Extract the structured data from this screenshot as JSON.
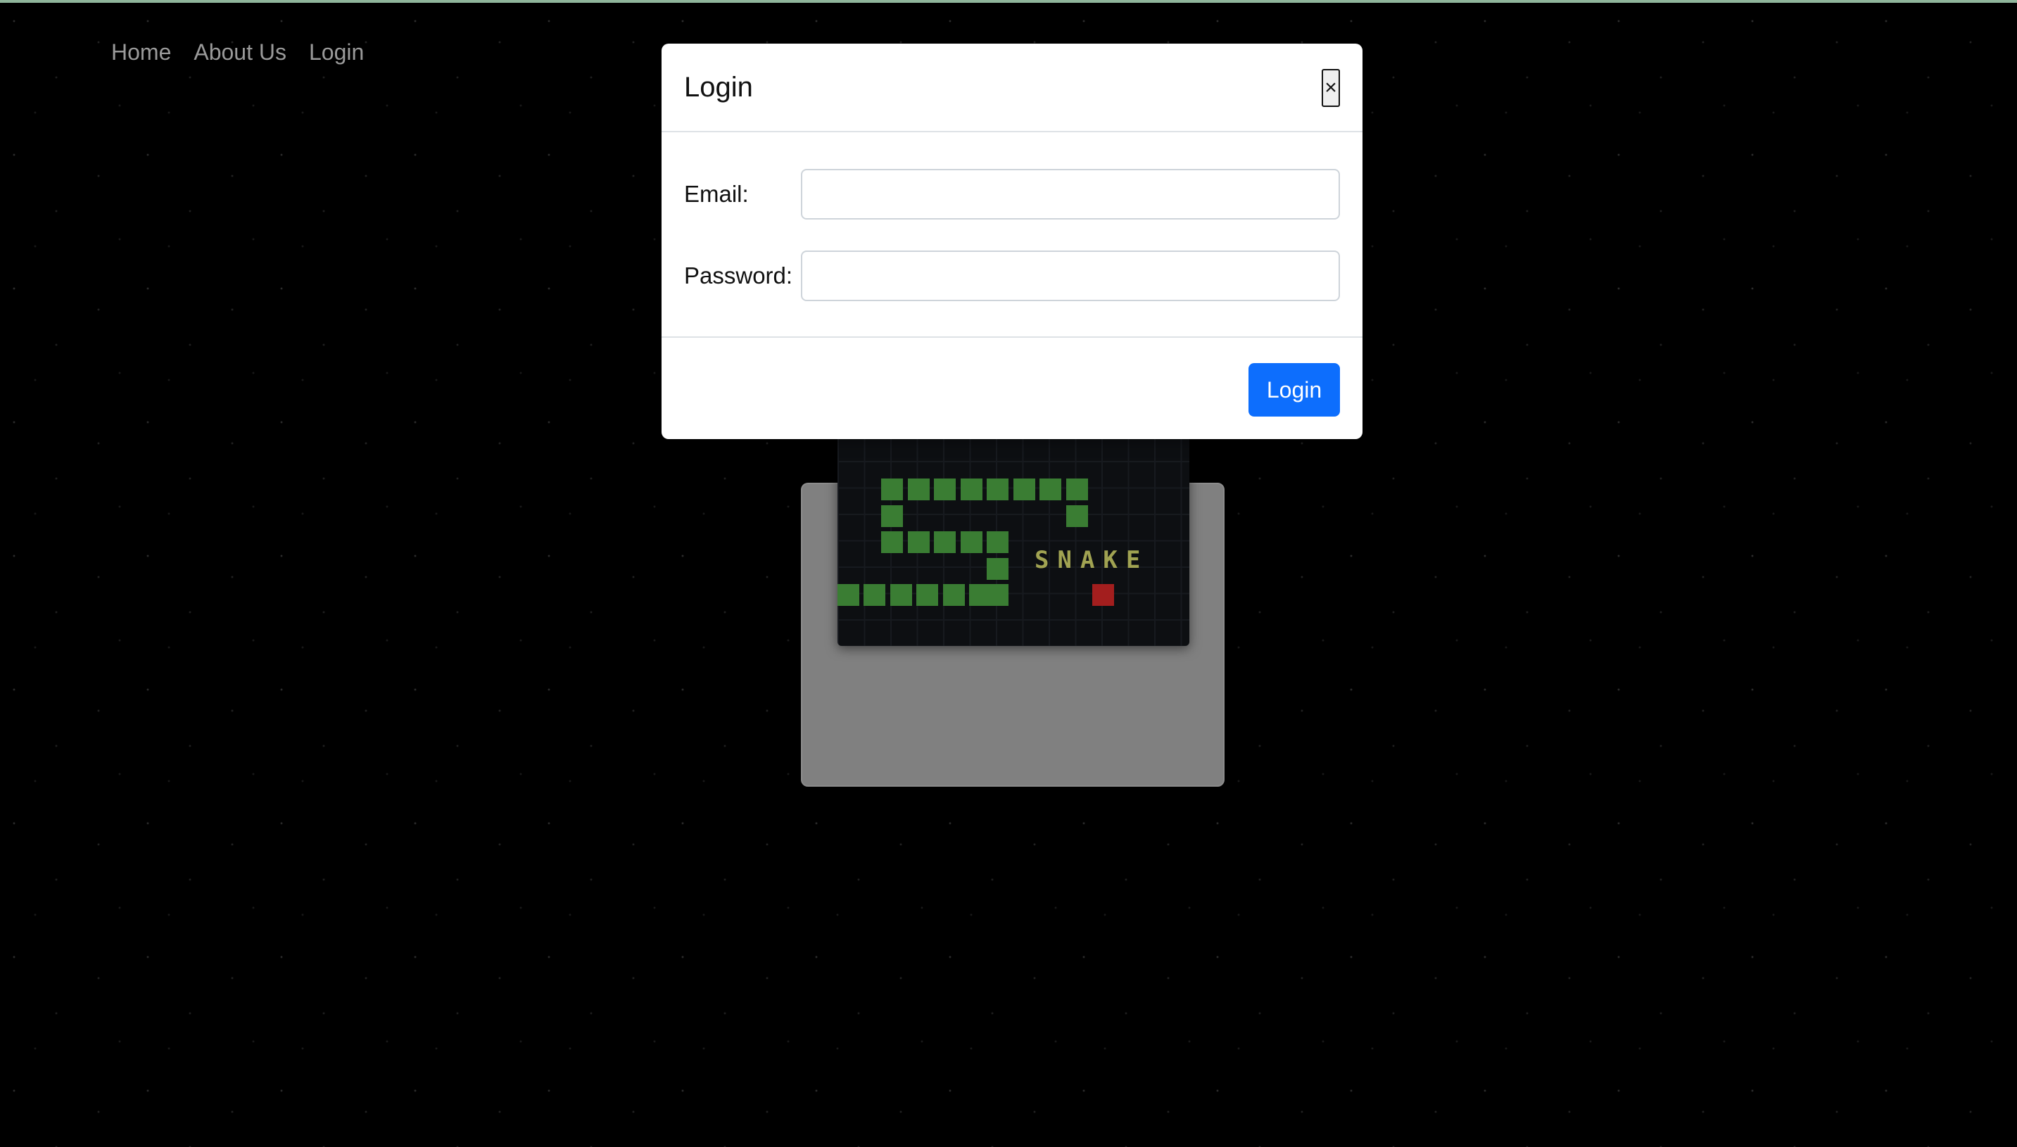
{
  "nav": {
    "items": [
      {
        "label": "Home"
      },
      {
        "label": "About Us"
      },
      {
        "label": "Login"
      }
    ]
  },
  "game": {
    "title_text": "SNAKE"
  },
  "modal": {
    "title": "Login",
    "close_label": "×",
    "email_label": "Email:",
    "email_value": "",
    "password_label": "Password:",
    "password_value": "",
    "submit_label": "Login"
  },
  "colors": {
    "primary": "#0d6efd",
    "snake": "#3a7d33",
    "food": "#a31e1e",
    "panel": "#808080",
    "background": "#000000"
  }
}
